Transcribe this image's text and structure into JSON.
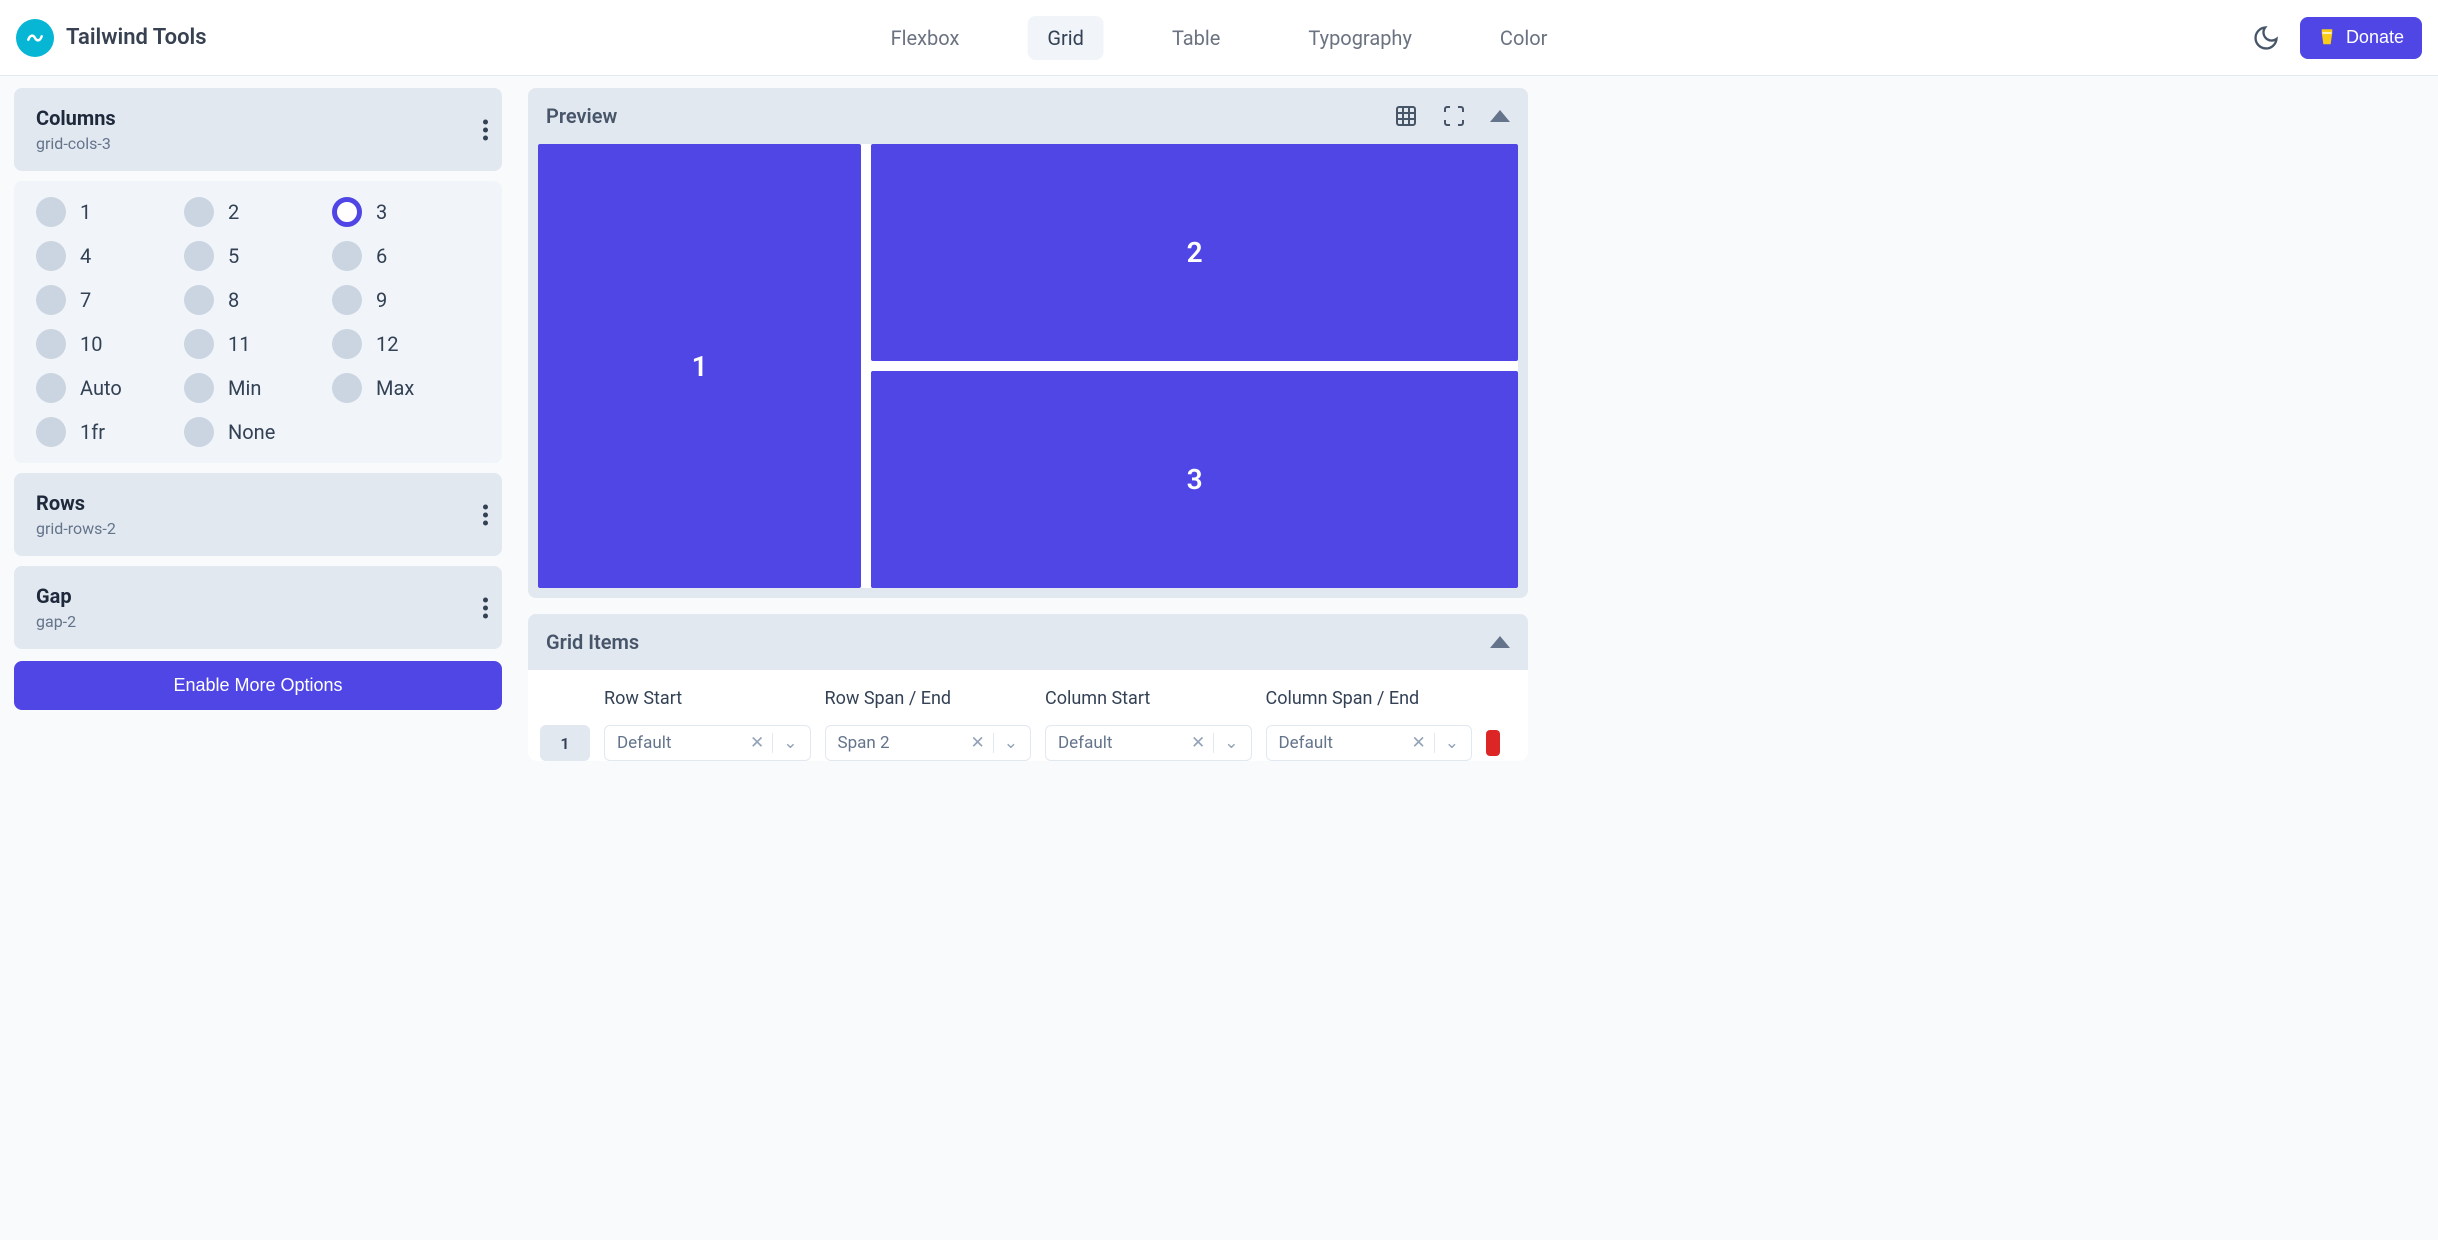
{
  "brand": {
    "name": "Tailwind Tools"
  },
  "nav": {
    "flexbox": "Flexbox",
    "grid": "Grid",
    "table": "Table",
    "typography": "Typography",
    "color": "Color"
  },
  "header": {
    "donate": "Donate"
  },
  "sidebar": {
    "columns": {
      "title": "Columns",
      "sub": "grid-cols-3"
    },
    "options": {
      "o1": "1",
      "o2": "2",
      "o3": "3",
      "o4": "4",
      "o5": "5",
      "o6": "6",
      "o7": "7",
      "o8": "8",
      "o9": "9",
      "o10": "10",
      "o11": "11",
      "o12": "12",
      "auto": "Auto",
      "min": "Min",
      "max": "Max",
      "fr": "1fr",
      "none": "None"
    },
    "rows": {
      "title": "Rows",
      "sub": "grid-rows-2"
    },
    "gap": {
      "title": "Gap",
      "sub": "gap-2"
    },
    "enable": "Enable More Options"
  },
  "preview": {
    "title": "Preview",
    "cell1": "1",
    "cell2": "2",
    "cell3": "3"
  },
  "gridItems": {
    "title": "Grid Items",
    "headers": {
      "rowStart": "Row Start",
      "rowSpan": "Row Span / End",
      "colStart": "Column Start",
      "colSpan": "Column Span / End"
    },
    "row1": {
      "num": "1",
      "rowStart": "Default",
      "rowSpan": "Span 2",
      "colStart": "Default",
      "colSpan": "Default"
    }
  }
}
